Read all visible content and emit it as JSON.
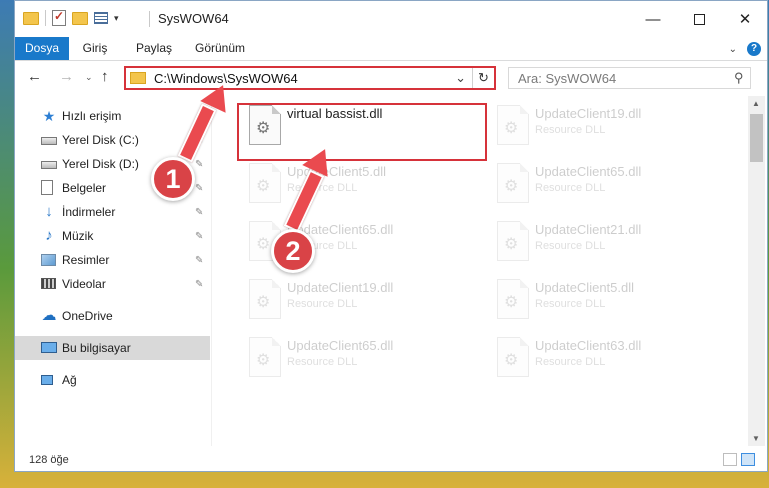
{
  "window": {
    "title": "SysWOW64",
    "minimize_glyph": "—",
    "close_glyph": "✕"
  },
  "ribbon": {
    "tabs": [
      "Dosya",
      "Giriş",
      "Paylaş",
      "Görünüm"
    ],
    "help_glyph": "?",
    "expand_glyph": "⌄"
  },
  "navigation": {
    "back_glyph": "←",
    "forward_glyph": "→",
    "recent_glyph": "⌄",
    "up_glyph": "↑",
    "address": "C:\\Windows\\SysWOW64",
    "address_drop_glyph": "⌄",
    "refresh_glyph": "↻",
    "search_placeholder": "Ara: SysWOW64",
    "search_glyph": "⚲"
  },
  "sidebar": {
    "items": [
      {
        "label": "Hızlı erişim",
        "icon": "star-icon"
      },
      {
        "label": "Yerel Disk (C:)",
        "icon": "disk-icon",
        "pinned": true
      },
      {
        "label": "Yerel Disk (D:)",
        "icon": "disk-icon",
        "pinned": true
      },
      {
        "label": "Belgeler",
        "icon": "document-icon",
        "pinned": true
      },
      {
        "label": "İndirmeler",
        "icon": "download-icon",
        "pinned": true
      },
      {
        "label": "Müzik",
        "icon": "music-icon",
        "pinned": true
      },
      {
        "label": "Resimler",
        "icon": "pictures-icon",
        "pinned": true
      },
      {
        "label": "Videolar",
        "icon": "videos-icon",
        "pinned": true
      },
      {
        "label": "OneDrive",
        "icon": "cloud-icon"
      },
      {
        "label": "Bu bilgisayar",
        "icon": "computer-icon",
        "selected": true
      },
      {
        "label": "Ağ",
        "icon": "network-icon"
      }
    ],
    "pin_glyph": "📌"
  },
  "files": [
    {
      "name": "virtual bassist.dll",
      "type": ""
    },
    {
      "name": "UpdateClient19.dll",
      "type": "Resource DLL"
    },
    {
      "name": "UpdateClient5.dll",
      "type": "Resource DLL"
    },
    {
      "name": "UpdateClient65.dll",
      "type": "Resource DLL"
    },
    {
      "name": "UpdateClient65.dll",
      "type": "Resource DLL"
    },
    {
      "name": "UpdateClient21.dll",
      "type": "Resource DLL"
    },
    {
      "name": "UpdateClient19.dll",
      "type": "Resource DLL"
    },
    {
      "name": "UpdateClient5.dll",
      "type": "Resource DLL"
    },
    {
      "name": "UpdateClient65.dll",
      "type": "Resource DLL"
    },
    {
      "name": "UpdateClient63.dll",
      "type": "Resource DLL"
    }
  ],
  "status": {
    "count": "128 öğe"
  },
  "annotations": {
    "step1": "1",
    "step2": "2",
    "highlight_color": "#d6323a"
  },
  "colors": {
    "accent": "#1979ca",
    "annotation": "#d94347"
  }
}
